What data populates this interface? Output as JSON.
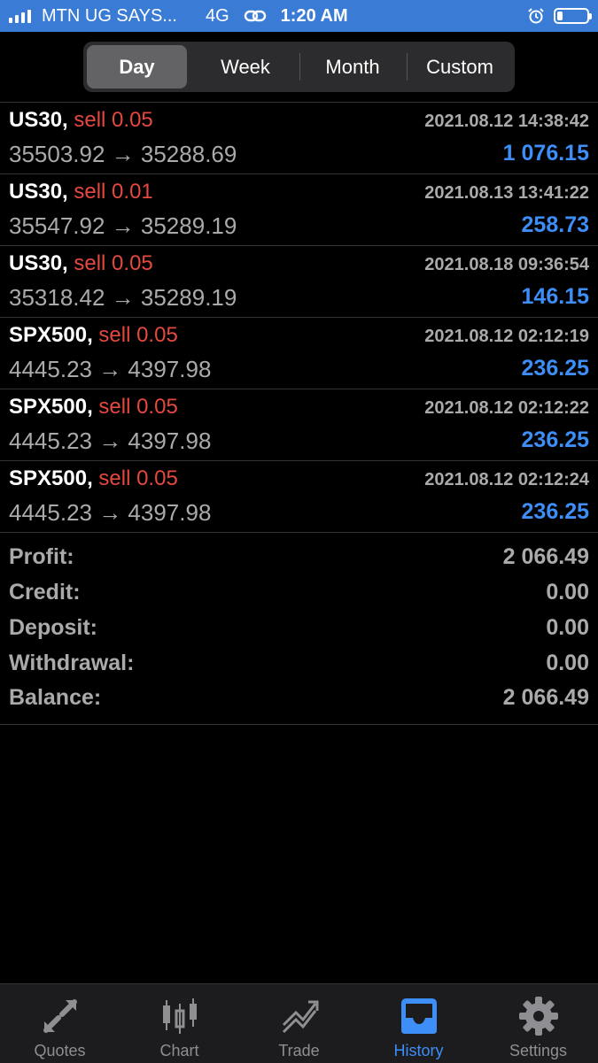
{
  "status_bar": {
    "carrier": "MTN UG SAYS...",
    "network": "4G",
    "time": "1:20 AM"
  },
  "period_tabs": [
    {
      "label": "Day",
      "active": true
    },
    {
      "label": "Week",
      "active": false
    },
    {
      "label": "Month",
      "active": false
    },
    {
      "label": "Custom",
      "active": false
    }
  ],
  "deals": [
    {
      "symbol": "US30,",
      "side": "sell 0.05",
      "time": "2021.08.12 14:38:42",
      "prices": "35503.92 → 35288.69",
      "profit": "1 076.15"
    },
    {
      "symbol": "US30,",
      "side": "sell 0.01",
      "time": "2021.08.13 13:41:22",
      "prices": "35547.92 → 35289.19",
      "profit": "258.73"
    },
    {
      "symbol": "US30,",
      "side": "sell 0.05",
      "time": "2021.08.18 09:36:54",
      "prices": "35318.42 → 35289.19",
      "profit": "146.15"
    },
    {
      "symbol": "SPX500,",
      "side": "sell 0.05",
      "time": "2021.08.12 02:12:19",
      "prices": "4445.23 → 4397.98",
      "profit": "236.25"
    },
    {
      "symbol": "SPX500,",
      "side": "sell 0.05",
      "time": "2021.08.12 02:12:22",
      "prices": "4445.23 → 4397.98",
      "profit": "236.25"
    },
    {
      "symbol": "SPX500,",
      "side": "sell 0.05",
      "time": "2021.08.12 02:12:24",
      "prices": "4445.23 → 4397.98",
      "profit": "236.25"
    }
  ],
  "summary": [
    {
      "label": "Profit:",
      "value": "2 066.49"
    },
    {
      "label": "Credit:",
      "value": "0.00"
    },
    {
      "label": "Deposit:",
      "value": "0.00"
    },
    {
      "label": "Withdrawal:",
      "value": "0.00"
    },
    {
      "label": "Balance:",
      "value": "2 066.49"
    }
  ],
  "tab_bar": [
    {
      "label": "Quotes",
      "icon": "quotes-icon",
      "active": false
    },
    {
      "label": "Chart",
      "icon": "candlestick-chart-icon",
      "active": false
    },
    {
      "label": "Trade",
      "icon": "trade-trend-icon",
      "active": false
    },
    {
      "label": "History",
      "icon": "inbox-tray-icon",
      "active": true
    },
    {
      "label": "Settings",
      "icon": "gear-icon",
      "active": false
    }
  ],
  "colors": {
    "status_bar": "#3a7bd5",
    "sell": "#e5483f",
    "profit": "#3d8ef7",
    "active_tab": "#3d8ef7",
    "inactive_tab": "#8e8e93"
  }
}
